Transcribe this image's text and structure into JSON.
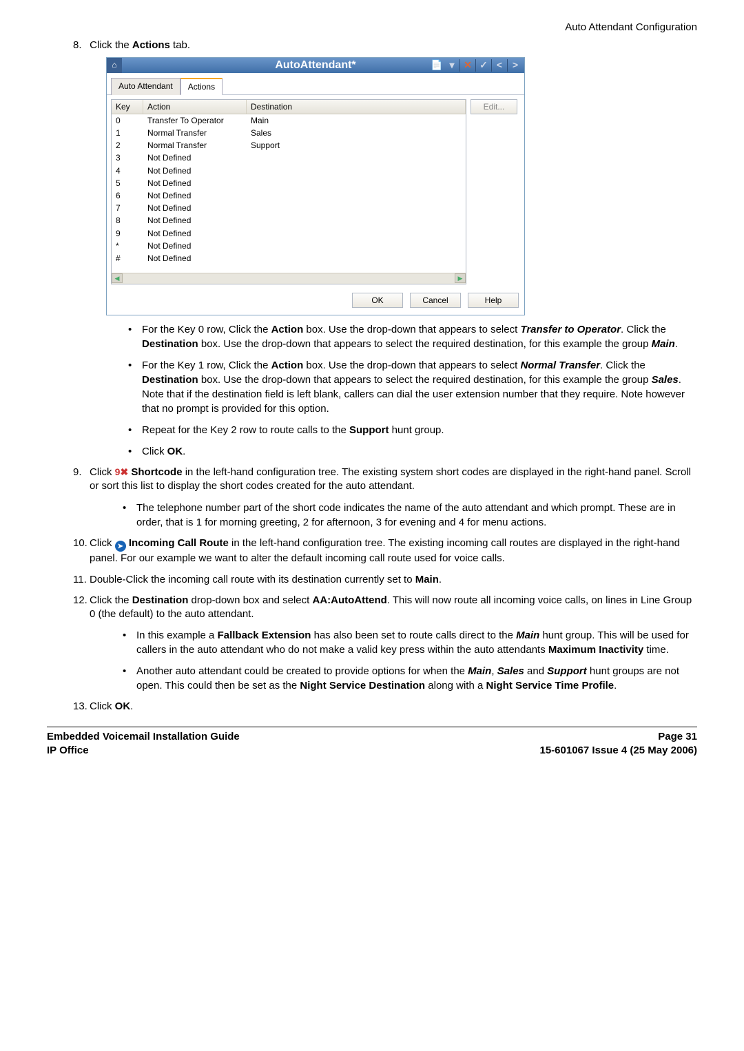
{
  "header_right": "Auto Attendant Configuration",
  "step8": {
    "num": "8.",
    "pre": "Click the ",
    "bold": "Actions",
    "post": " tab."
  },
  "window": {
    "title": "AutoAttendant*",
    "toolbar": {
      "new": "📄",
      "close": "✕",
      "ok": "✓",
      "prev": "<",
      "next": ">"
    },
    "tabs": {
      "auto": "Auto Attendant",
      "actions": "Actions"
    },
    "columns": {
      "key": "Key",
      "action": "Action",
      "dest": "Destination"
    },
    "rows": [
      {
        "key": "0",
        "action": "Transfer To Operator",
        "dest": "Main"
      },
      {
        "key": "1",
        "action": "Normal Transfer",
        "dest": "Sales"
      },
      {
        "key": "2",
        "action": "Normal Transfer",
        "dest": "Support"
      },
      {
        "key": "3",
        "action": "Not Defined",
        "dest": ""
      },
      {
        "key": "4",
        "action": "Not Defined",
        "dest": ""
      },
      {
        "key": "5",
        "action": "Not Defined",
        "dest": ""
      },
      {
        "key": "6",
        "action": "Not Defined",
        "dest": ""
      },
      {
        "key": "7",
        "action": "Not Defined",
        "dest": ""
      },
      {
        "key": "8",
        "action": "Not Defined",
        "dest": ""
      },
      {
        "key": "9",
        "action": "Not Defined",
        "dest": ""
      },
      {
        "key": "*",
        "action": "Not Defined",
        "dest": ""
      },
      {
        "key": "#",
        "action": "Not Defined",
        "dest": ""
      }
    ],
    "edit": "Edit...",
    "ok": "OK",
    "cancel": "Cancel",
    "help": "Help"
  },
  "b1": {
    "p1a": "For the Key 0 row, Click the ",
    "p1b": "Action",
    "p1c": " box. Use the drop-down that appears to select ",
    "p1d": "Transfer to Operator",
    "p1e": ". Click the ",
    "p1f": "Destination",
    "p1g": " box. Use the drop-down that appears to select the required destination, for this example the group ",
    "p1h": "Main",
    "p1i": "."
  },
  "b2": {
    "a": "For the Key 1 row, Click the ",
    "b": "Action",
    "c": " box. Use the drop-down that appears to select ",
    "d": "Normal Transfer",
    "e": ". Click the ",
    "f": "Destination",
    "g": " box. Use the drop-down that appears to select the required destination, for this example the group ",
    "h": "Sales",
    "i": ". Note that if the destination field is left blank, callers can dial the user extension number that they require. Note however that no prompt is provided for this option."
  },
  "b3": {
    "a": "Repeat for the Key 2 row to route calls to the ",
    "b": "Support",
    "c": " hunt group."
  },
  "b4": {
    "a": "Click ",
    "b": "OK",
    "c": "."
  },
  "step9": {
    "num": "9.",
    "a": "Click ",
    "b": " Shortcode",
    "c": " in the left-hand configuration tree. The existing system short codes are displayed in the right-hand panel. Scroll or sort this list to display the short codes created for the auto attendant."
  },
  "b5": "The telephone number part of the short code indicates the name of the auto attendant and which prompt. These are in order, that is 1 for morning greeting, 2 for afternoon, 3 for evening and 4 for menu actions.",
  "step10": {
    "num": "10.",
    "a": "Click ",
    "b": " Incoming Call Route",
    "c": " in the left-hand configuration tree. The existing incoming call routes are displayed in the right-hand panel. For our example we want to alter the default incoming call route used for voice calls."
  },
  "step11": {
    "num": "11.",
    "a": "Double-Click the incoming call route with its destination currently set to ",
    "b": "Main",
    "c": "."
  },
  "step12": {
    "num": "12.",
    "a": "Click the ",
    "b": "Destination",
    "c": " drop-down box and select ",
    "d": "AA:AutoAttend",
    "e": ". This will now route all incoming voice calls, on lines in Line Group 0 (the default) to the auto attendant."
  },
  "b6": {
    "a": "In this example a ",
    "b": "Fallback Extension",
    "c": " has also been set to route calls direct to the ",
    "d": "Main",
    "e": " hunt group. This will be used for callers in the auto attendant who do not make a valid key press within the auto attendants ",
    "f": "Maximum Inactivity",
    "g": " time."
  },
  "b7": {
    "a": "Another auto attendant could be created to provide options for when the ",
    "b": "Main",
    "c": ", ",
    "d": "Sales",
    "e": " and ",
    "f": "Support",
    "g": " hunt groups are not open. This could then be set as the ",
    "h": "Night Service Destination",
    "i": " along with a ",
    "j": "Night Service Time Profile",
    "k": "."
  },
  "step13": {
    "num": "13.",
    "a": "Click ",
    "b": "OK",
    "c": "."
  },
  "footer": {
    "l1l": "Embedded Voicemail Installation Guide",
    "l1r": "Page 31",
    "l2l": "IP Office",
    "l2r": "15-601067 Issue 4 (25 May 2006)"
  }
}
